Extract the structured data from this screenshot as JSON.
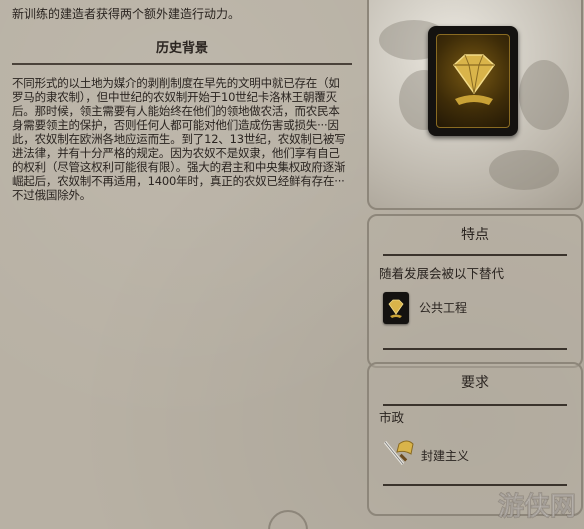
{
  "intro_text": "新训练的建造者获得两个额外建造行动力。",
  "history": {
    "title": "历史背景",
    "body": "不同形式的以土地为媒介的剥削制度在早先的文明中就已存在（如罗马的隶农制），但中世纪的农奴制开始于10世纪卡洛林王朝覆灭后。那时候，领主需要有人能始终在他们的领地做农活，而农民本身需要领主的保护，否则任何人都可能对他们造成伤害或损失···因此，农奴制在欧洲各地应运而生。到了12、13世纪，农奴制已被写进法律，并有十分严格的规定。因为农奴不是奴隶，他们享有自己的权利（尽管这权利可能很有限）。强大的君主和中央集权政府逐渐崛起后，农奴制不再适用，1400年时，真正的农奴已经鲜有存在···不过俄国除外。"
  },
  "features": {
    "title": "特点",
    "replaced_by_label": "随着发展会被以下替代",
    "replacement": {
      "name": "公共工程",
      "icon": "gold-diamond-card-icon"
    }
  },
  "requirements": {
    "title": "要求",
    "category": "市政",
    "item": {
      "name": "封建主义",
      "icon": "sword-scroll-icon"
    }
  },
  "watermark": "游侠网",
  "colors": {
    "background": "#b8b1a4",
    "text": "#2a2420",
    "panel_border": "#8d867a",
    "gold": "#c9a236"
  }
}
